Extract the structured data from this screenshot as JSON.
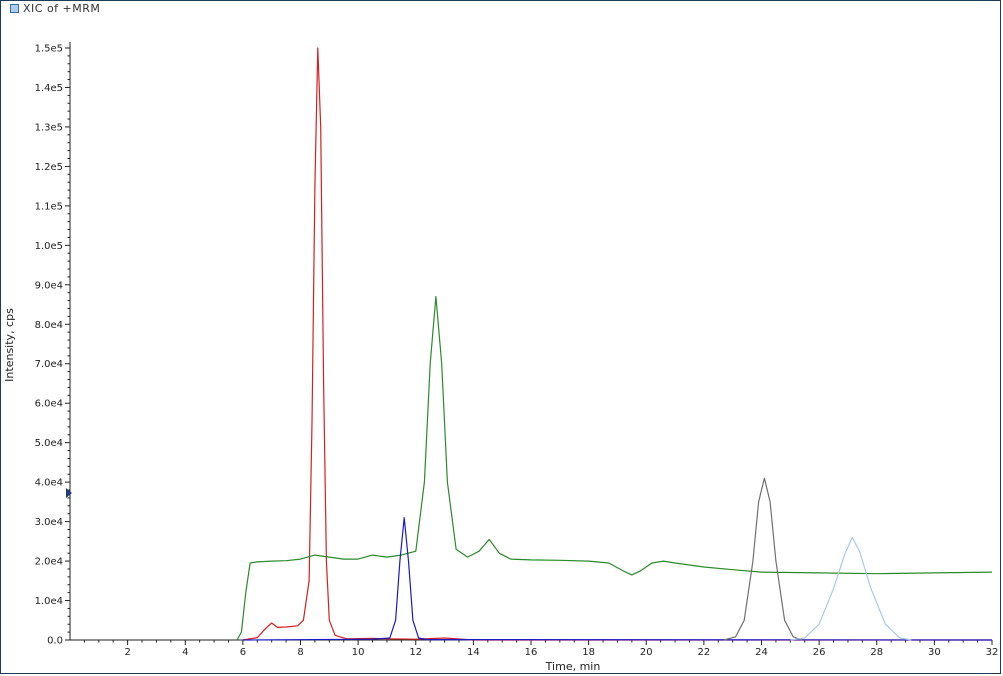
{
  "header": {
    "title": "XIC of +MRM"
  },
  "chart_data": {
    "type": "line",
    "title": "XIC of +MRM",
    "xlabel": "Time, min",
    "ylabel": "Intensity, cps",
    "xlim": [
      0,
      32
    ],
    "ylim": [
      0,
      150000
    ],
    "x_ticks": [
      "2",
      "4",
      "6",
      "8",
      "10",
      "12",
      "14",
      "16",
      "18",
      "20",
      "22",
      "24",
      "26",
      "28",
      "30",
      "32"
    ],
    "y_ticks": [
      "0.0",
      "1.0e4",
      "2.0e4",
      "3.0e4",
      "4.0e4",
      "5.0e4",
      "6.0e4",
      "7.0e4",
      "8.0e4",
      "9.0e4",
      "1.0e5",
      "1.1e5",
      "1.2e5",
      "1.3e5",
      "1.4e5",
      "1.5e5"
    ],
    "series": [
      {
        "color": "#d62020",
        "points": [
          [
            6.0,
            0
          ],
          [
            6.5,
            600
          ],
          [
            6.8,
            3000
          ],
          [
            7.0,
            4300
          ],
          [
            7.2,
            3200
          ],
          [
            7.5,
            3300
          ],
          [
            7.9,
            3600
          ],
          [
            8.1,
            5000
          ],
          [
            8.3,
            15000
          ],
          [
            8.4,
            55000
          ],
          [
            8.5,
            115000
          ],
          [
            8.6,
            150000
          ],
          [
            8.7,
            130000
          ],
          [
            8.8,
            65000
          ],
          [
            8.9,
            20000
          ],
          [
            9.0,
            5000
          ],
          [
            9.2,
            1200
          ],
          [
            9.6,
            300
          ],
          [
            10.5,
            400
          ],
          [
            11.0,
            300
          ],
          [
            12.0,
            200
          ],
          [
            13.0,
            500
          ],
          [
            14.0,
            0
          ],
          [
            32,
            0
          ]
        ]
      },
      {
        "color": "#2a8a2a",
        "points": [
          [
            5.8,
            0
          ],
          [
            5.95,
            2000
          ],
          [
            6.1,
            12000
          ],
          [
            6.25,
            19500
          ],
          [
            6.5,
            19800
          ],
          [
            7.0,
            20000
          ],
          [
            7.5,
            20100
          ],
          [
            8.0,
            20500
          ],
          [
            8.5,
            21500
          ],
          [
            9.0,
            21000
          ],
          [
            9.5,
            20500
          ],
          [
            10.0,
            20500
          ],
          [
            10.5,
            21500
          ],
          [
            11.0,
            21000
          ],
          [
            11.5,
            21500
          ],
          [
            12.0,
            22500
          ],
          [
            12.3,
            40000
          ],
          [
            12.5,
            70000
          ],
          [
            12.7,
            87000
          ],
          [
            12.9,
            70000
          ],
          [
            13.1,
            40000
          ],
          [
            13.4,
            23000
          ],
          [
            13.8,
            21000
          ],
          [
            14.2,
            22500
          ],
          [
            14.55,
            25500
          ],
          [
            14.9,
            22000
          ],
          [
            15.3,
            20500
          ],
          [
            16.0,
            20300
          ],
          [
            17.0,
            20200
          ],
          [
            18.0,
            20000
          ],
          [
            18.7,
            19500
          ],
          [
            19.2,
            17500
          ],
          [
            19.5,
            16500
          ],
          [
            19.8,
            17500
          ],
          [
            20.2,
            19500
          ],
          [
            20.6,
            20000
          ],
          [
            21.0,
            19500
          ],
          [
            22.0,
            18500
          ],
          [
            23.0,
            17800
          ],
          [
            24.0,
            17200
          ],
          [
            26.0,
            17000
          ],
          [
            28.0,
            16800
          ],
          [
            30.0,
            17000
          ],
          [
            32.0,
            17200
          ]
        ]
      },
      {
        "color": "#1a1ac8",
        "points": [
          [
            6,
            0
          ],
          [
            10.5,
            200
          ],
          [
            11.1,
            500
          ],
          [
            11.3,
            5000
          ],
          [
            11.45,
            20000
          ],
          [
            11.6,
            31000
          ],
          [
            11.75,
            20000
          ],
          [
            11.9,
            5000
          ],
          [
            12.1,
            500
          ],
          [
            12.4,
            100
          ],
          [
            32,
            0
          ]
        ]
      },
      {
        "color": "#707070",
        "points": [
          [
            22.7,
            0
          ],
          [
            23.1,
            800
          ],
          [
            23.4,
            5000
          ],
          [
            23.7,
            20000
          ],
          [
            23.9,
            35000
          ],
          [
            24.1,
            41000
          ],
          [
            24.3,
            35000
          ],
          [
            24.5,
            20000
          ],
          [
            24.8,
            5000
          ],
          [
            25.1,
            800
          ],
          [
            25.4,
            0
          ]
        ]
      },
      {
        "color": "#a8c8e6",
        "points": [
          [
            25.0,
            0
          ],
          [
            25.5,
            500
          ],
          [
            26.0,
            4000
          ],
          [
            26.5,
            13000
          ],
          [
            26.9,
            22000
          ],
          [
            27.15,
            26000
          ],
          [
            27.4,
            22500
          ],
          [
            27.8,
            13000
          ],
          [
            28.3,
            4000
          ],
          [
            28.8,
            500
          ],
          [
            29.2,
            0
          ]
        ]
      }
    ]
  }
}
